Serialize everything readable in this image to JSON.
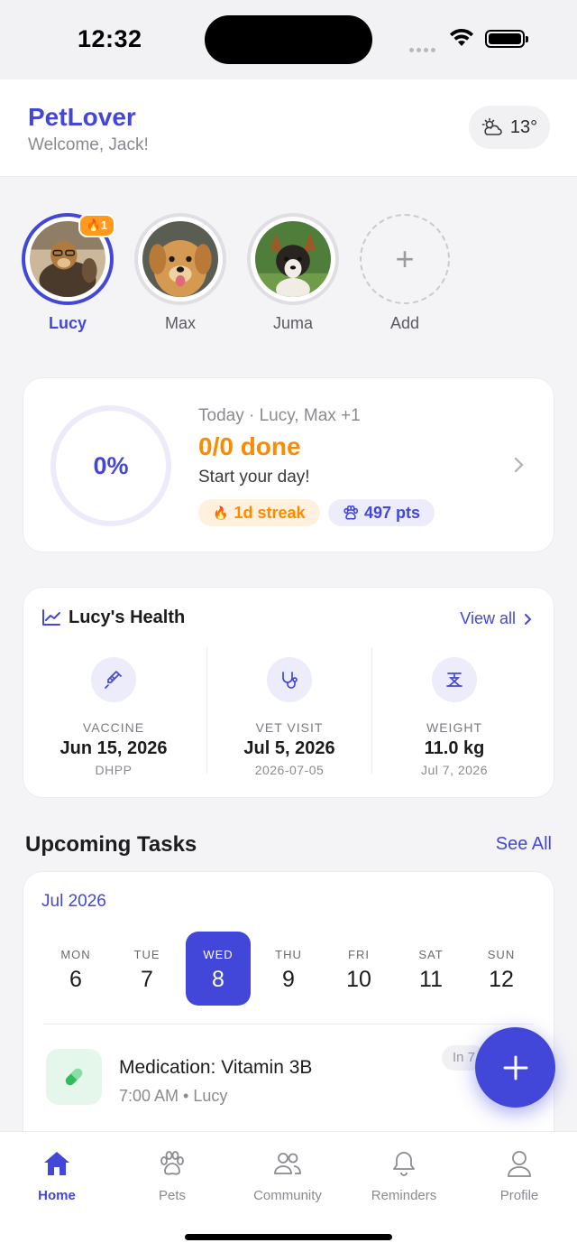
{
  "status_bar": {
    "time": "12:32"
  },
  "header": {
    "app_title": "PetLover",
    "welcome": "Welcome, Jack!",
    "weather_temp": "13°",
    "weather_icon": "cloud-sun-icon"
  },
  "pets": [
    {
      "name": "Lucy",
      "badge": "1",
      "active": true
    },
    {
      "name": "Max",
      "active": false
    },
    {
      "name": "Juma",
      "active": false
    }
  ],
  "add_pet_label": "Add",
  "progress": {
    "percent": "0%",
    "today_line": "Today · Lucy, Max +1",
    "done_line": "0/0 done",
    "message": "Start your day!",
    "streak": "1d streak",
    "points": "497 pts"
  },
  "health": {
    "title": "Lucy's Health",
    "view_all": "View all",
    "items": [
      {
        "label": "VACCINE",
        "value": "Jun 15, 2026",
        "sub": "DHPP",
        "icon": "syringe-icon"
      },
      {
        "label": "VET VISIT",
        "value": "Jul 5, 2026",
        "sub": "2026-07-05",
        "icon": "stethoscope-icon"
      },
      {
        "label": "WEIGHT",
        "value": "11.0 kg",
        "sub": "Jul 7, 2026",
        "icon": "scale-icon"
      }
    ]
  },
  "tasks": {
    "section_title": "Upcoming Tasks",
    "see_all": "See All",
    "month": "Jul 2026",
    "days": [
      {
        "name": "MON",
        "num": "6"
      },
      {
        "name": "TUE",
        "num": "7"
      },
      {
        "name": "WED",
        "num": "8",
        "selected": true
      },
      {
        "name": "THU",
        "num": "9"
      },
      {
        "name": "FRI",
        "num": "10"
      },
      {
        "name": "SAT",
        "num": "11"
      },
      {
        "name": "SUN",
        "num": "12"
      }
    ],
    "items": [
      {
        "title": "Medication: Vitamin 3B",
        "subtitle": "7:00 AM • Lucy",
        "status": "In 7",
        "icon": "pill-icon"
      }
    ]
  },
  "tabbar": [
    {
      "label": "Home",
      "icon": "home-icon",
      "active": true
    },
    {
      "label": "Pets",
      "icon": "paw-icon"
    },
    {
      "label": "Community",
      "icon": "users-icon"
    },
    {
      "label": "Reminders",
      "icon": "bell-icon"
    },
    {
      "label": "Profile",
      "icon": "user-icon"
    }
  ],
  "colors": {
    "accent": "#4347d9",
    "orange": "#ff8a00",
    "green": "#2ebd59"
  }
}
